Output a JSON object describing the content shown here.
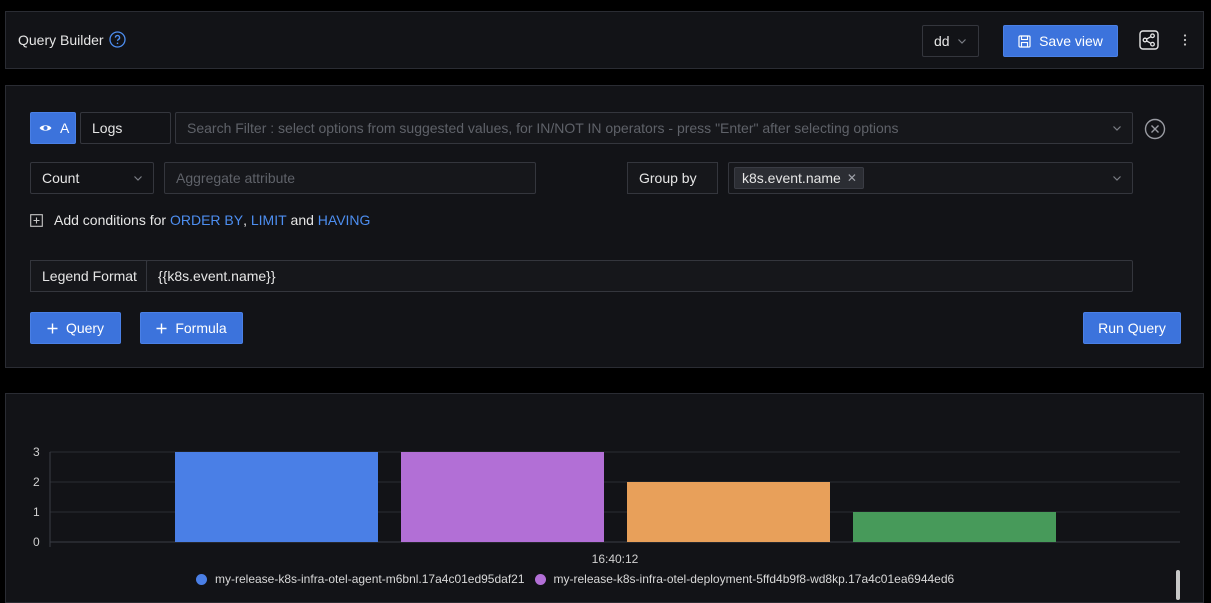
{
  "header": {
    "title": "Query Builder",
    "view_select_value": "dd",
    "save_view_label": "Save view"
  },
  "query": {
    "query_letter": "A",
    "data_source": "Logs",
    "search_placeholder": "Search Filter : select options from suggested values, for IN/NOT IN operators - press \"Enter\" after selecting options",
    "aggregate_operator": "Count",
    "aggregate_attribute_placeholder": "Aggregate attribute",
    "group_by_label": "Group by",
    "group_by_tags": [
      "k8s.event.name"
    ],
    "conditions": {
      "prefix": "Add conditions for",
      "order_by": "ORDER BY",
      "comma": ",",
      "limit": "LIMIT",
      "and": "and",
      "having": "HAVING"
    },
    "legend_format_label": "Legend Format",
    "legend_format_value": "{{k8s.event.name}}",
    "add_query_label": "Query",
    "add_formula_label": "Formula",
    "run_query_label": "Run Query"
  },
  "chart_data": {
    "type": "bar",
    "x_label": "16:40:12",
    "ylim": [
      0,
      3
    ],
    "yticks": [
      "0",
      "1",
      "2",
      "3"
    ],
    "grid": true,
    "legend_position": "bottom",
    "series": [
      {
        "name": "my-release-k8s-infra-otel-agent-m6bnl.17a4c01ed95daf21",
        "value": 3,
        "color": "#4a7fe6"
      },
      {
        "name": "my-release-k8s-infra-otel-deployment-5ffd4b9f8-wd8kp.17a4c01ea6944ed6",
        "value": 3,
        "color": "#b26fd6"
      },
      {
        "name": "",
        "value": 2,
        "color": "#e8a05a"
      },
      {
        "name": "",
        "value": 1,
        "color": "#479a5a"
      }
    ]
  }
}
